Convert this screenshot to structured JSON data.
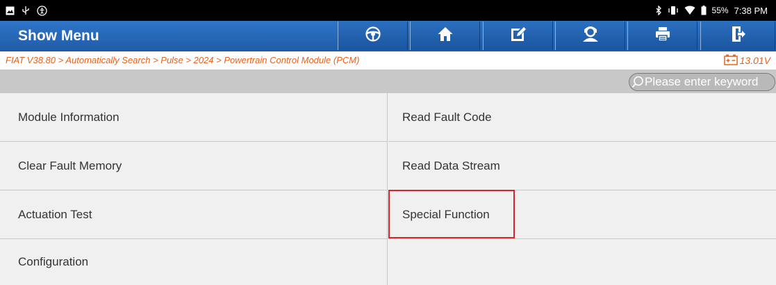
{
  "status_bar": {
    "left_icons": [
      "image-icon",
      "usb-icon",
      "accessibility-icon"
    ],
    "right_icons": [
      "bluetooth-icon",
      "vibrate-icon",
      "wifi-icon",
      "battery-icon"
    ],
    "battery": "55%",
    "time": "7:38 PM"
  },
  "header": {
    "title": "Show Menu",
    "buttons": [
      {
        "name": "steering-wheel-icon"
      },
      {
        "name": "home-icon"
      },
      {
        "name": "edit-icon"
      },
      {
        "name": "support-icon"
      },
      {
        "name": "print-icon"
      },
      {
        "name": "exit-icon"
      }
    ]
  },
  "breadcrumb": {
    "text": "FIAT V38.80 > Automatically Search > Pulse > 2024 > Powertrain Control Module (PCM)",
    "voltage": "13.01V"
  },
  "search": {
    "placeholder": "Please enter keyword"
  },
  "menu": {
    "items": [
      "Module Information",
      "Read Fault Code",
      "Clear Fault Memory",
      "Read Data Stream",
      "Actuation Test",
      "Special Function",
      "Configuration",
      ""
    ],
    "highlighted": "Special Function"
  },
  "colors": {
    "header_blue": "#1f5ba7",
    "breadcrumb_orange": "#e8611a",
    "highlight_red": "#d9232d"
  }
}
